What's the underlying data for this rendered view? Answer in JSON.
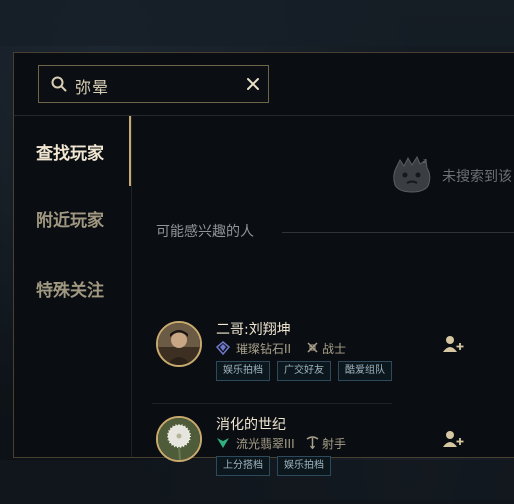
{
  "search": {
    "value": "弥晕"
  },
  "sidebar": {
    "items": [
      {
        "label": "查找玩家",
        "active": true
      },
      {
        "label": "附近玩家",
        "active": false
      },
      {
        "label": "特殊关注",
        "active": false
      }
    ]
  },
  "empty_state": {
    "icon": "poro-icon",
    "text": "未搜索到该"
  },
  "suggestions": {
    "title": "可能感兴趣的人",
    "players": [
      {
        "name": "二哥:刘翔坤",
        "rank": "璀璨钻石II",
        "rank_icon": "diamond-rank-icon",
        "role": "战士",
        "role_icon": "fighter-icon",
        "tags": [
          "娱乐拍档",
          "广交好友",
          "酷爱组队"
        ]
      },
      {
        "name": "消化的世纪",
        "rank": "流光翡翠III",
        "rank_icon": "emerald-rank-icon",
        "role": "射手",
        "role_icon": "marksman-icon",
        "tags": [
          "上分搭档",
          "娱乐拍档"
        ]
      }
    ]
  },
  "colors": {
    "gold": "#c8aa6e",
    "text": "#f0e6d2",
    "panel": "#0a0d11"
  }
}
